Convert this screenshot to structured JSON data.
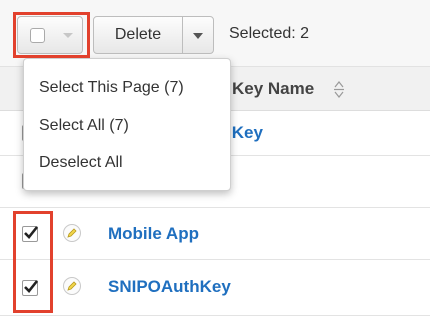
{
  "toolbar": {
    "delete_label": "Delete",
    "selected_text": "Selected: 2"
  },
  "table": {
    "column_header": "Key Name",
    "rows": [
      {
        "name": "Support Portal Key",
        "checked": false
      },
      {
        "name": "",
        "checked": false
      },
      {
        "name": "Mobile App",
        "checked": true
      },
      {
        "name": "SNIPOAuthKey",
        "checked": true
      }
    ]
  },
  "dropdown": {
    "items": [
      "Select This Page (7)",
      "Select All (7)",
      "Deselect All"
    ]
  },
  "colors": {
    "highlight": "#e2412d",
    "link": "#1f6fbf"
  },
  "icons": [
    "checkbox-icon",
    "chevron-down-icon",
    "sort-icon",
    "pencil-icon",
    "checkmark-icon"
  ]
}
